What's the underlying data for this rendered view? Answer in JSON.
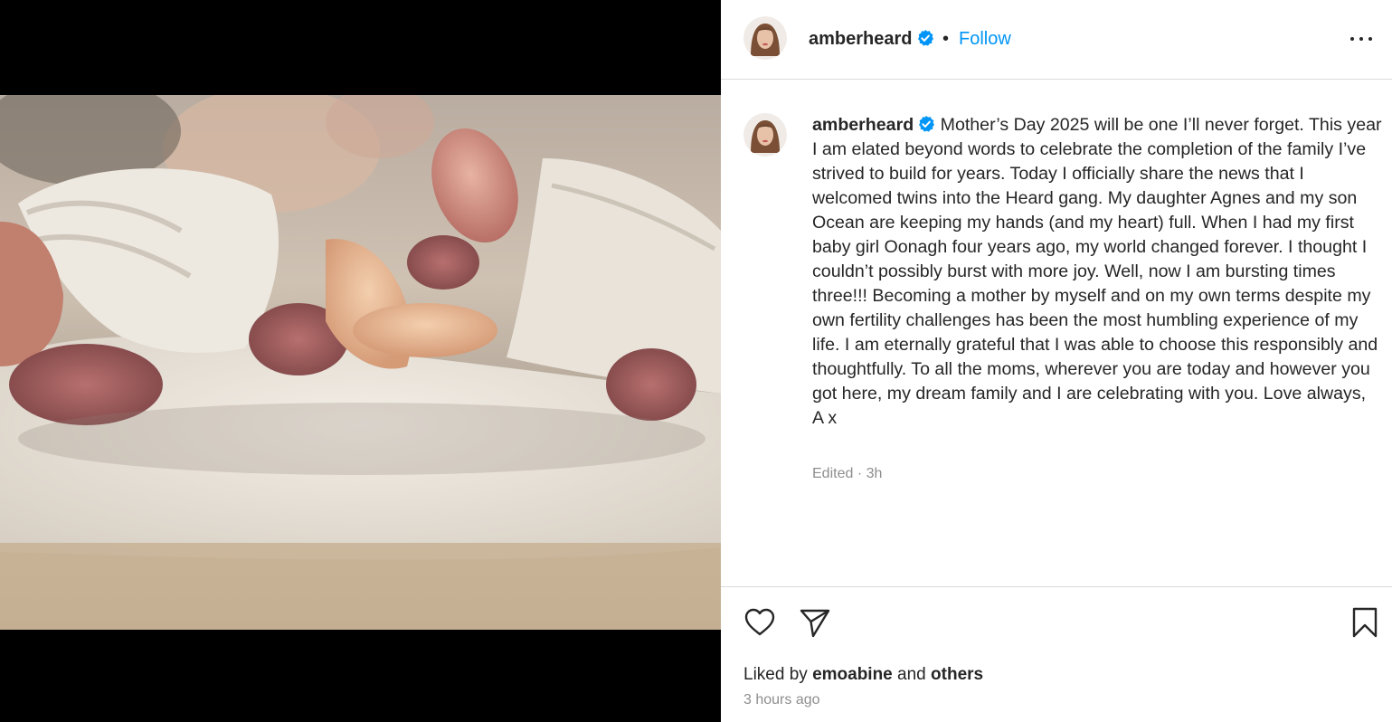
{
  "post": {
    "username": "amberheard",
    "header_separator": "•",
    "follow_label": "Follow",
    "caption_text": "Mother’s Day 2025 will be one I’ll never forget. This year I am elated beyond words to celebrate the completion of the family I’ve strived to build for years. Today I officially share the news that I welcomed twins into the Heard gang. My daughter Agnes and my son Ocean are keeping my hands (and my heart) full. When I had my first baby girl Oonagh four years ago, my world changed forever. I thought I couldn’t possibly burst with more joy. Well, now I am bursting times three!!! Becoming a mother by myself and on my own terms despite my own fertility challenges has been the most humbling experience of my life. I am eternally grateful that I was able to choose this responsibly and thoughtfully. To all the moms, wherever you are today and however you got here, my dream family and I are celebrating with you. Love always,\nA x",
    "caption_meta": "Edited · 3h",
    "liked_by_prefix": "Liked by",
    "liked_by_user": "emoabine",
    "liked_by_and": "and",
    "liked_by_others": "others",
    "timestamp": "3 hours ago"
  },
  "icons": {
    "verified": "verified-badge-icon",
    "more": "more-options-icon",
    "like": "heart-icon",
    "share": "share-paper-plane-icon",
    "save": "bookmark-icon"
  },
  "colors": {
    "accent": "#0095f6",
    "text": "#262626",
    "muted": "#8e8e8e",
    "border": "#dbdbdb",
    "media_bg": "#000000"
  }
}
